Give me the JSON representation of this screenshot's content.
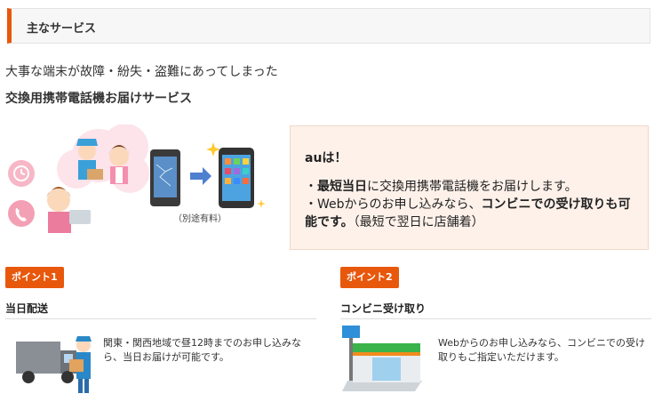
{
  "header": {
    "title": "主なサービス"
  },
  "intro": {
    "line1": "大事な端末が故障・紛失・盗難にあってしまった",
    "service_name": "交換用携帯電話機お届けサービス"
  },
  "hero": {
    "caption": "（別途有料）",
    "icons": [
      "clock-icon",
      "phone-icon",
      "broken-phone-icon",
      "new-phone-icon",
      "arrow-right-icon"
    ]
  },
  "au_box": {
    "heading": "auは！",
    "line1_prefix": "・",
    "line1_bold": "最短当日",
    "line1_rest": "に交換用携帯電話機をお届けします。",
    "line2_prefix": "・Webからのお申し込みなら、",
    "line2_bold": "コンビニでの受け取りも可能です。",
    "line2_rest": "（最短で翌日に店舗着）"
  },
  "points": [
    {
      "badge": "ポイント1",
      "title": "当日配送",
      "description": "関東・関西地域で昼12時までのお申し込みなら、当日お届けが可能です。"
    },
    {
      "badge": "ポイント2",
      "title": "コンビニ受け取り",
      "description": "Webからのお申し込みなら、コンビニでの受け取りもご指定いただけます。"
    }
  ],
  "colors": {
    "accent": "#e8580c",
    "box_bg": "#fdf1ea"
  }
}
